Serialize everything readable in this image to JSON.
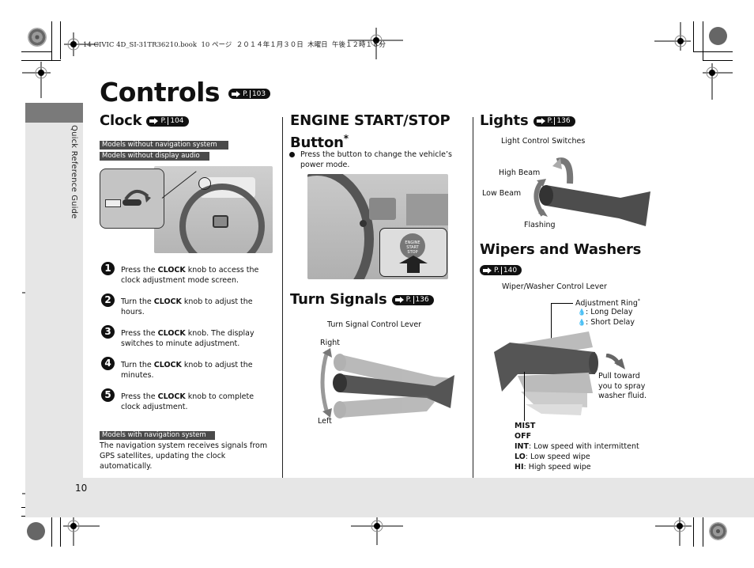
{
  "print_header": "14 CIVIC 4D_SI-31TR36210.book  10 ページ  ２０１４年１月３０日  木曜日  午後１２時１８分",
  "side_tab_label": "Quick Reference Guide",
  "page_title": "Controls",
  "page_title_ref": "103",
  "page_number": "10",
  "ref_prefix": "P.",
  "clock": {
    "heading": "Clock",
    "ref": "104",
    "tags": [
      "Models without navigation system",
      "Models without display audio"
    ],
    "steps": [
      {
        "num": "1",
        "pre": "Press the ",
        "bold": "CLOCK",
        "post": " knob to access the clock adjustment mode screen."
      },
      {
        "num": "2",
        "pre": "Turn the ",
        "bold": "CLOCK",
        "post": " knob to adjust the hours."
      },
      {
        "num": "3",
        "pre": "Press the ",
        "bold": "CLOCK",
        "post": " knob. The display switches to minute adjustment."
      },
      {
        "num": "4",
        "pre": "Turn the ",
        "bold": "CLOCK",
        "post": " knob to adjust the minutes."
      },
      {
        "num": "5",
        "pre": "Press the ",
        "bold": "CLOCK",
        "post": " knob to complete clock adjustment."
      }
    ],
    "nav_tag": "Models with navigation system",
    "nav_text": "The navigation system receives signals from GPS satellites, updating the clock automatically."
  },
  "engine": {
    "heading_line1": "ENGINE START/STOP",
    "heading_line2": "Button",
    "asterisk": "*",
    "bullet": "Press the button to change the vehicle’s power mode.",
    "button_labels": [
      "ENGINE",
      "START",
      "STOP"
    ]
  },
  "turn_signals": {
    "heading": "Turn Signals",
    "ref": "136",
    "caption": "Turn Signal Control Lever",
    "right_label": "Right",
    "left_label": "Left"
  },
  "lights": {
    "heading": "Lights",
    "ref": "136",
    "caption": "Light Control Switches",
    "high_beam": "High Beam",
    "low_beam": "Low Beam",
    "flashing": "Flashing"
  },
  "wipers": {
    "heading": "Wipers and Washers",
    "ref": "140",
    "caption": "Wiper/Washer Control Lever",
    "adjustment_ring": "Adjustment Ring",
    "asterisk": "*",
    "long_delay": ": Long Delay",
    "short_delay": ": Short Delay",
    "pull_text": [
      "Pull toward",
      "you to spray",
      "washer fluid."
    ],
    "modes": [
      {
        "bold": "MIST",
        "text": ""
      },
      {
        "bold": "OFF",
        "text": ""
      },
      {
        "bold": "INT",
        "text": ": Low speed with intermittent"
      },
      {
        "bold": "LO",
        "text": ": Low speed wipe"
      },
      {
        "bold": "HI",
        "text": ": High speed wipe"
      }
    ]
  }
}
